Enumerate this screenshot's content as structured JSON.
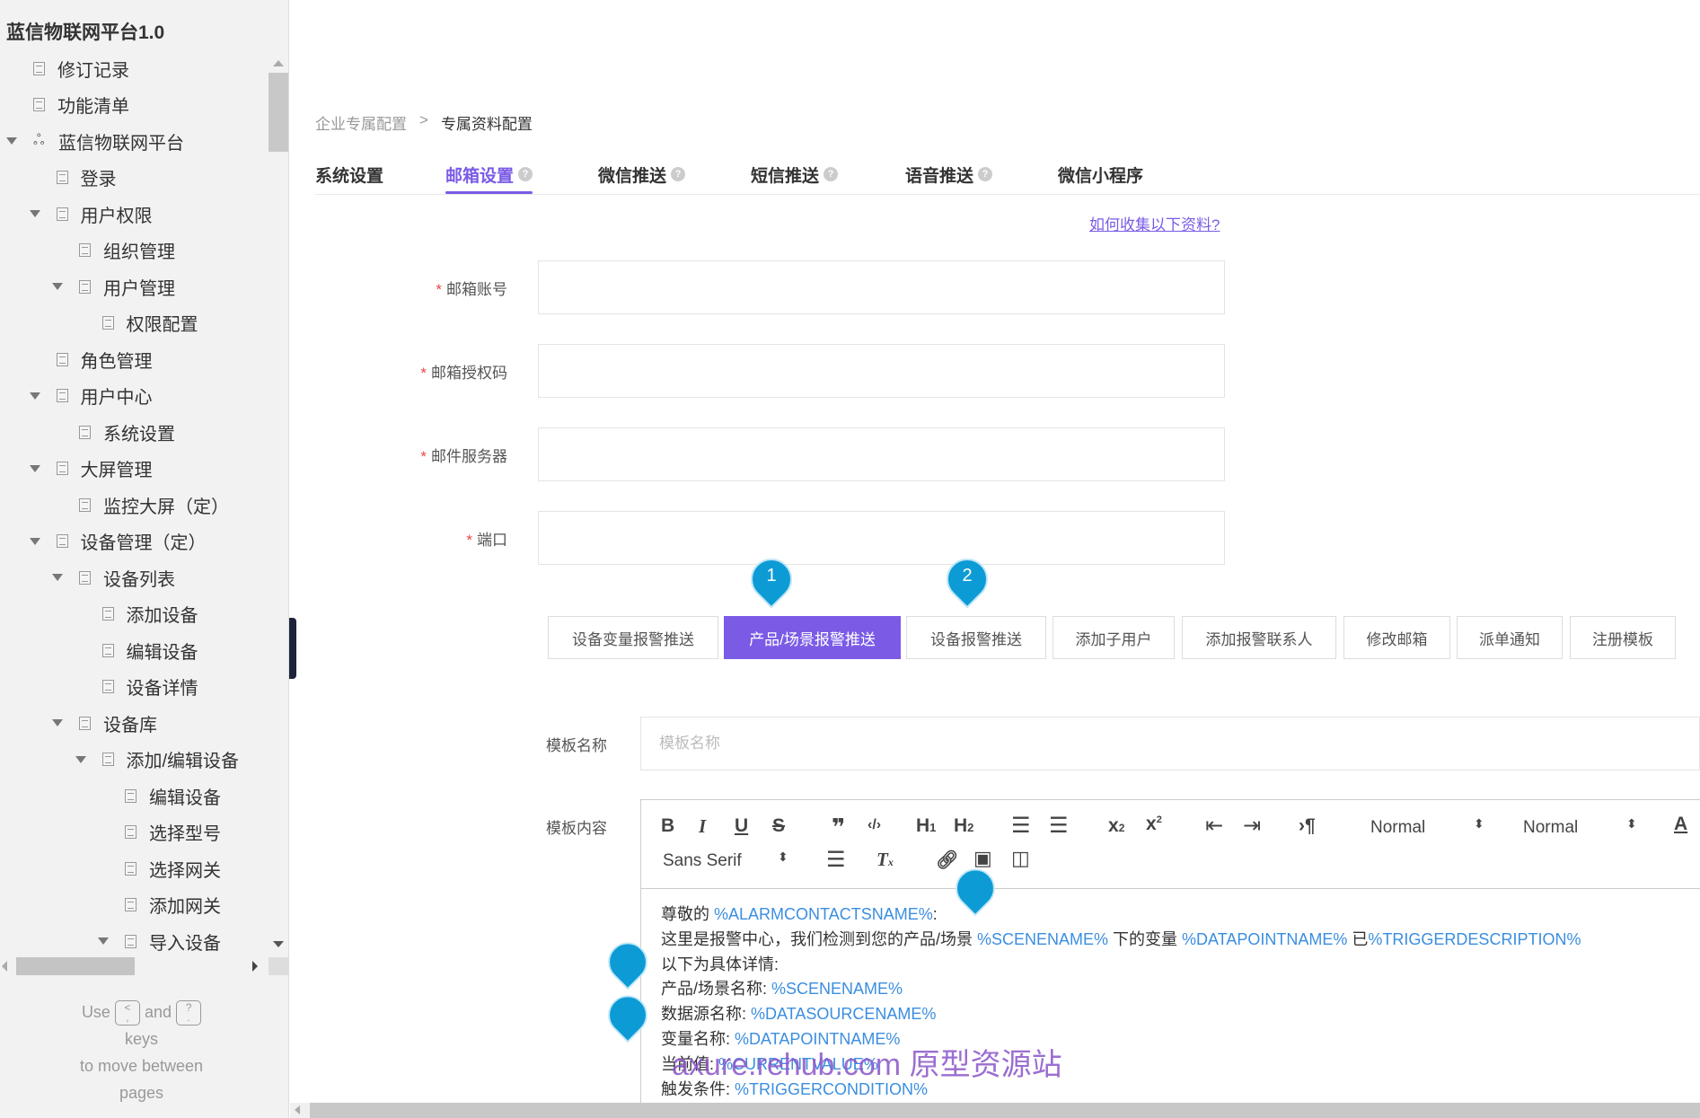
{
  "sidebar": {
    "title": "蓝信物联网平台1.0",
    "items": [
      {
        "label": "修订记录",
        "level": 0,
        "icon": "document-icon"
      },
      {
        "label": "功能清单",
        "level": 0,
        "icon": "document-icon"
      },
      {
        "label": "蓝信物联网平台",
        "level": 0,
        "icon": "sitemap-icon",
        "expanded": true
      },
      {
        "label": "登录",
        "level": 1,
        "icon": "document-icon"
      },
      {
        "label": "用户权限",
        "level": 1,
        "icon": "document-icon",
        "expanded": true
      },
      {
        "label": "组织管理",
        "level": 2,
        "icon": "document-icon"
      },
      {
        "label": "用户管理",
        "level": 2,
        "icon": "document-icon",
        "expanded": true
      },
      {
        "label": "权限配置",
        "level": 3,
        "icon": "document-icon"
      },
      {
        "label": "角色管理",
        "level": 1,
        "icon": "document-icon"
      },
      {
        "label": "用户中心",
        "level": 1,
        "icon": "document-icon",
        "expanded": true
      },
      {
        "label": "系统设置",
        "level": 2,
        "icon": "document-icon"
      },
      {
        "label": "大屏管理",
        "level": 1,
        "icon": "document-icon",
        "expanded": true
      },
      {
        "label": "监控大屏（定）",
        "level": 2,
        "icon": "document-icon"
      },
      {
        "label": "设备管理（定）",
        "level": 1,
        "icon": "document-icon",
        "expanded": true
      },
      {
        "label": "设备列表",
        "level": 2,
        "icon": "document-icon",
        "expanded": true
      },
      {
        "label": "添加设备",
        "level": 3,
        "icon": "document-icon"
      },
      {
        "label": "编辑设备",
        "level": 3,
        "icon": "document-icon"
      },
      {
        "label": "设备详情",
        "level": 3,
        "icon": "document-icon"
      },
      {
        "label": "设备库",
        "level": 2,
        "icon": "document-icon",
        "expanded": true
      },
      {
        "label": "添加/编辑设备",
        "level": 3,
        "icon": "document-icon",
        "expanded": true
      },
      {
        "label": "编辑设备",
        "level": 4,
        "icon": "document-icon"
      },
      {
        "label": "选择型号",
        "level": 4,
        "icon": "document-icon"
      },
      {
        "label": "选择网关",
        "level": 4,
        "icon": "document-icon"
      },
      {
        "label": "添加网关",
        "level": 4,
        "icon": "document-icon"
      },
      {
        "label": "导入设备",
        "level": 4,
        "icon": "document-icon",
        "expanded": true
      }
    ],
    "help": {
      "use": "Use",
      "key1_top": "<",
      "key1_bottom": ",",
      "and": "and",
      "key2_top": "?",
      "key2_bottom": ".",
      "keys": "keys",
      "line2": "to move between",
      "line3": "pages"
    }
  },
  "breadcrumb": {
    "parent": "企业专属配置",
    "separator": ">",
    "current": "专属资料配置"
  },
  "tabs": [
    {
      "label": "系统设置",
      "help": false
    },
    {
      "label": "邮箱设置",
      "help": true,
      "active": true
    },
    {
      "label": "微信推送",
      "help": true
    },
    {
      "label": "短信推送",
      "help": true
    },
    {
      "label": "语音推送",
      "help": true
    },
    {
      "label": "微信小程序",
      "help": false
    }
  ],
  "help_glyph": "?",
  "help_link": "如何收集以下资料?",
  "form": {
    "required_mark": "*",
    "fields": [
      {
        "label": "邮箱账号",
        "value": ""
      },
      {
        "label": "邮箱授权码",
        "value": ""
      },
      {
        "label": "邮件服务器",
        "value": ""
      },
      {
        "label": "端口",
        "value": ""
      }
    ]
  },
  "template_buttons": [
    {
      "label": "设备变量报警推送"
    },
    {
      "label": "产品/场景报警推送",
      "active": true
    },
    {
      "label": "设备报警推送"
    },
    {
      "label": "添加子用户"
    },
    {
      "label": "添加报警联系人"
    },
    {
      "label": "修改邮箱"
    },
    {
      "label": "派单通知"
    },
    {
      "label": "注册模板"
    }
  ],
  "annotations": [
    "1",
    "2"
  ],
  "template": {
    "name_label": "模板名称",
    "name_placeholder": "模板名称",
    "name_value": "",
    "content_label": "模板内容",
    "toolbar": {
      "header_select": "Normal",
      "size_select": "Normal",
      "font_select": "Sans Serif"
    },
    "content": [
      [
        {
          "t": "尊敬的 "
        },
        {
          "v": "%ALARMCONTACTSNAME%"
        },
        {
          "t": ":"
        }
      ],
      [
        {
          "t": "这里是报警中心，我们检测到您的产品/场景 "
        },
        {
          "v": "%SCENENAME%"
        },
        {
          "t": " 下的变量 "
        },
        {
          "v": "%DATAPOINTNAME%"
        },
        {
          "t": " 已"
        },
        {
          "v": "%TRIGGERDESCRIPTION%"
        }
      ],
      [
        {
          "t": "以下为具体详情:"
        }
      ],
      [
        {
          "t": "产品/场景名称: "
        },
        {
          "v": "%SCENENAME%"
        }
      ],
      [
        {
          "t": "数据源名称: "
        },
        {
          "v": "%DATASOURCENAME%"
        }
      ],
      [
        {
          "t": "变量名称: "
        },
        {
          "v": "%DATAPOINTNAME%"
        }
      ],
      [
        {
          "t": "当前值: "
        },
        {
          "v": "%CURRENTVALUE%"
        }
      ],
      [
        {
          "t": "触发条件: "
        },
        {
          "v": "%TRIGGERCONDITION%"
        }
      ]
    ]
  },
  "watermark": "axure.rehub.com 原型资源站",
  "colors": {
    "accent": "#7b5be6",
    "variable": "#3b8ee0",
    "pin": "#0d9bd6",
    "required": "#e44444"
  }
}
